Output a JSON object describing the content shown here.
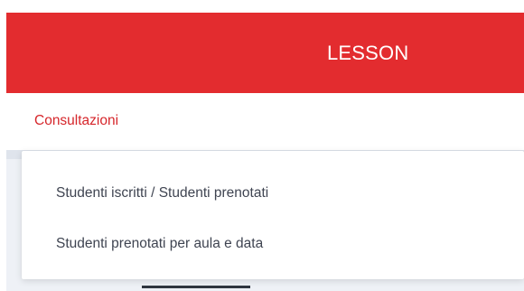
{
  "header": {
    "title": "LESSON",
    "background_color": "#e32c2f"
  },
  "section": {
    "label": "Consultazioni",
    "accent_color": "#d6262b"
  },
  "dropdown": {
    "items": [
      {
        "label": "Studenti iscritti / Studenti prenotati"
      },
      {
        "label": "Studenti prenotati per aula e data"
      }
    ]
  }
}
